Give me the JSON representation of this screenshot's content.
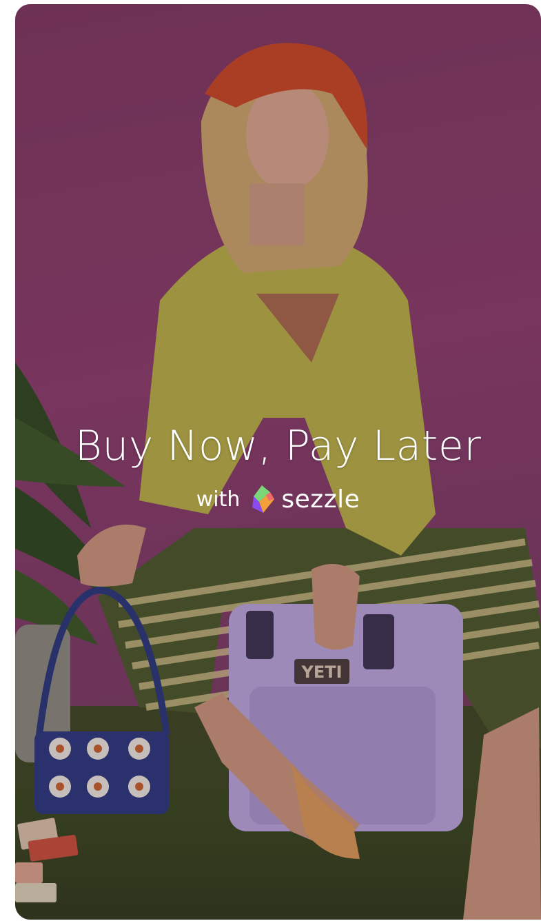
{
  "promo": {
    "headline": "Buy Now, Pay Later",
    "with_text": "with",
    "brand_name": "sezzle",
    "brand_logo_icon": "sezzle-logo-icon",
    "image_description_icon": "model-photo-image"
  },
  "colors": {
    "text": "#ffffff",
    "background_top": "#7d3a5f",
    "logo_green": "#7bd67a",
    "logo_purple": "#8a4cf0",
    "logo_orange": "#f2a03a"
  }
}
